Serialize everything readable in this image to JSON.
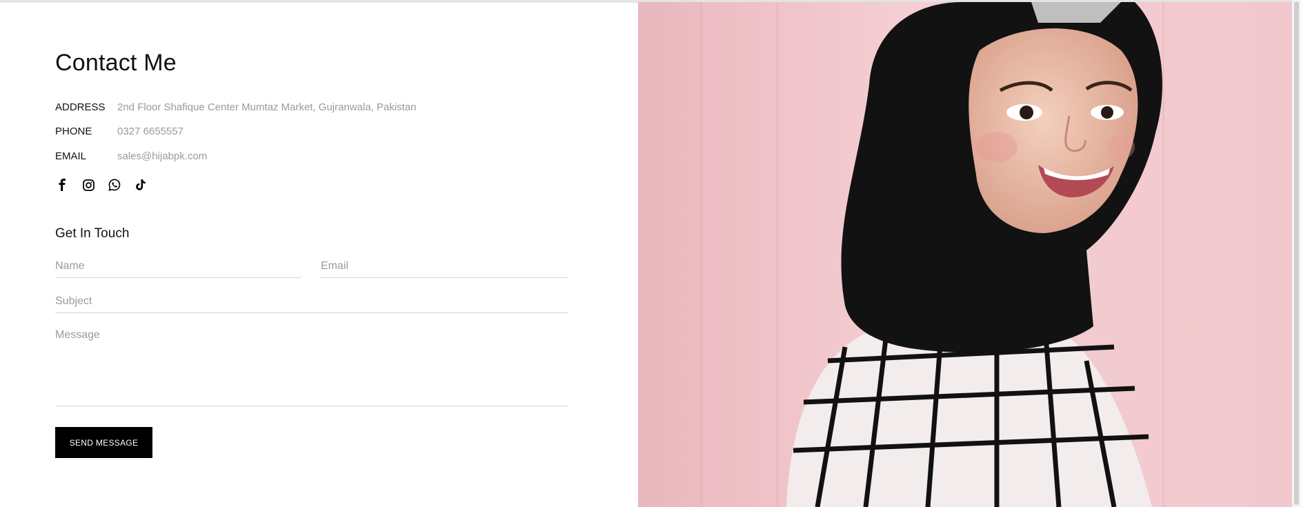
{
  "contact": {
    "title": "Contact Me",
    "info": [
      {
        "label": "ADDRESS",
        "value": "2nd Floor Shafique Center Mumtaz Market, Gujranwala, Pakistan"
      },
      {
        "label": "PHONE",
        "value": "0327 6655557"
      },
      {
        "label": "EMAIL",
        "value": "sales@hijabpk.com"
      }
    ],
    "social_icons": [
      "facebook-icon",
      "instagram-icon",
      "whatsapp-icon",
      "tiktok-icon"
    ]
  },
  "form": {
    "title": "Get In Touch",
    "name_placeholder": "Name",
    "email_placeholder": "Email",
    "subject_placeholder": "Subject",
    "message_placeholder": "Message",
    "submit_label": "SEND MESSAGE"
  },
  "colors": {
    "accent": "#000000",
    "muted_text": "#9a9a9a",
    "photo_background": "#f3cdd1"
  }
}
